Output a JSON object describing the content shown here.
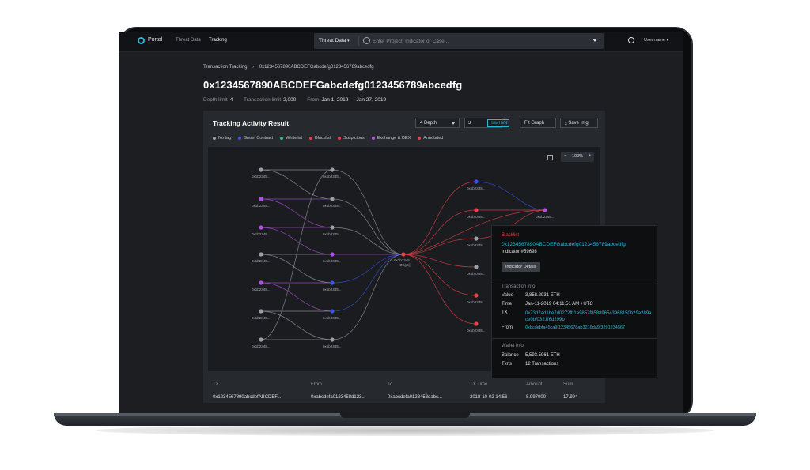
{
  "nav": {
    "brand": "Portal",
    "links": [
      "Threat Data",
      "Tracking"
    ],
    "search_scope": "Threat Data",
    "search_placeholder": "Enter Project, Indicator or Case...",
    "user": "User name"
  },
  "breadcrumb": [
    "Transaction Tracking",
    "›",
    "0x1234567890ABCDEFGabcdefg0123456789abcedfg"
  ],
  "page": {
    "title": "0x1234567890ABCDEFGabcdefg0123456789abcedfg",
    "depth_label": "Depth limit",
    "depth_value": "4",
    "tx_label": "Transaction limit",
    "tx_value": "2,000",
    "from_label": "From",
    "from_value": "Jan 1, 2019 — Jan 27, 2019"
  },
  "card": {
    "title": "Tracking Activity Result",
    "depth_select": "4 Depth",
    "depth_input": "3",
    "hvn_tag": "Hide HVN",
    "fit_graph": "Fit Graph",
    "save_img": "Save Img",
    "zoom": "100%",
    "legend": [
      {
        "label": "No tag",
        "color": "#9aa0a6"
      },
      {
        "label": "Smart Contract",
        "color": "#3a55e6"
      },
      {
        "label": "Whitelist",
        "color": "#3fbf7f"
      },
      {
        "label": "Blacklist",
        "color": "#e8424a"
      },
      {
        "label": "Suspicious",
        "color": "#e8424a"
      },
      {
        "label": "Exchange & DEX",
        "color": "#b24fe0"
      },
      {
        "label": "Annotated",
        "color": "#e8424a"
      }
    ],
    "node_label": "0x1b2345...",
    "origin_label": "[Origin]"
  },
  "table": {
    "headers": [
      "TX",
      "From",
      "To",
      "TX Time",
      "Amount",
      "Sum"
    ],
    "row": [
      "0x1234567890abcdefABCDEF...",
      "0xabcdefa0123458d123...",
      "0xabcdefa0123458dabc...",
      "2018-10-02 14:56",
      "8.997000",
      "17.994"
    ]
  },
  "popover": {
    "tag": "Blacklist",
    "address": "0x1234567890ABCDEFGabcdefg0123456789abcedfg",
    "indicator": "Indicator #59698",
    "button": "Indicator Details",
    "tx_section": "Transaction info",
    "value_key": "Value",
    "value": "3,858.2931 ETH",
    "time_key": "Time",
    "time": "Jan-11-2019 04:11:51 AM +UTC",
    "tx_key": "TX",
    "tx": "0x73d7ad1be7d0272fb1a9857f8588965c3968150b29a289ace0bf0321f6d299b",
    "from_key": "From",
    "from": "0xbcdebfa45ca9f12345678ab3216da9f3291234567",
    "wallet_section": "Wallet info",
    "balance_key": "Balance",
    "balance": "5,593.5961 ETH",
    "txns_key": "Txns",
    "txns": "12 Transactions"
  }
}
